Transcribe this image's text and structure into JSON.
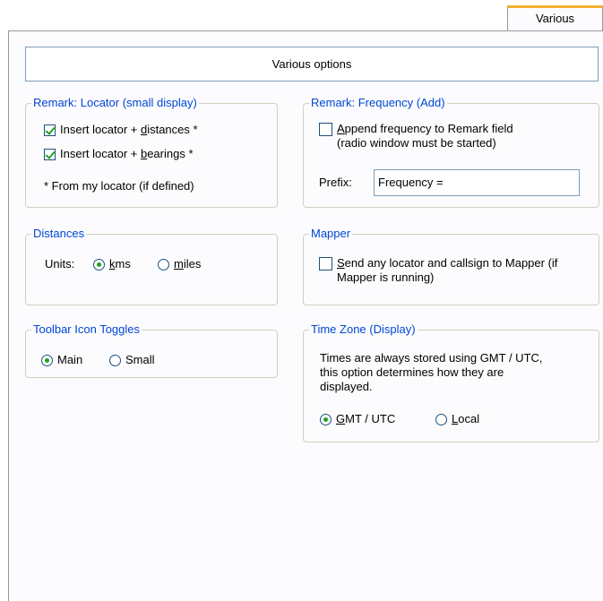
{
  "tab": {
    "label": "Various"
  },
  "header": {
    "title": "Various options"
  },
  "remark_locator": {
    "legend": "Remark: Locator (small display)",
    "insert_distances": {
      "pre": "Insert locator + ",
      "key": "d",
      "post": "istances *",
      "checked": true
    },
    "insert_bearings": {
      "pre": "Insert locator + ",
      "key": "b",
      "post": "earings *",
      "checked": true
    },
    "note": "* From my locator (if defined)"
  },
  "remark_frequency": {
    "legend": "Remark: Frequency (Add)",
    "append": {
      "key": "A",
      "post": "ppend frequency to Remark field",
      "line2": "(radio window must be started)",
      "checked": false
    },
    "prefix_label": "Prefix:",
    "prefix_value": "Frequency ="
  },
  "distances": {
    "legend": "Distances",
    "units_label": "Units:",
    "kms": {
      "key": "k",
      "post": "ms",
      "checked": true
    },
    "miles": {
      "key": "m",
      "post": "iles",
      "checked": false
    }
  },
  "mapper": {
    "legend": "Mapper",
    "send": {
      "key": "S",
      "post": "end any locator and callsign to Mapper (if",
      "line2": "Mapper is running)",
      "checked": false
    }
  },
  "toolbar": {
    "legend": "Toolbar Icon Toggles",
    "main": {
      "label": "Main",
      "checked": true
    },
    "small": {
      "label": "Small",
      "checked": false
    }
  },
  "timezone": {
    "legend": "Time Zone (Display)",
    "desc1": "Times are always stored using GMT / UTC,",
    "desc2": "this option determines how they are",
    "desc3": "displayed.",
    "gmt": {
      "key": "G",
      "post": "MT / UTC",
      "checked": true
    },
    "local": {
      "key": "L",
      "post": "ocal",
      "checked": false
    }
  }
}
